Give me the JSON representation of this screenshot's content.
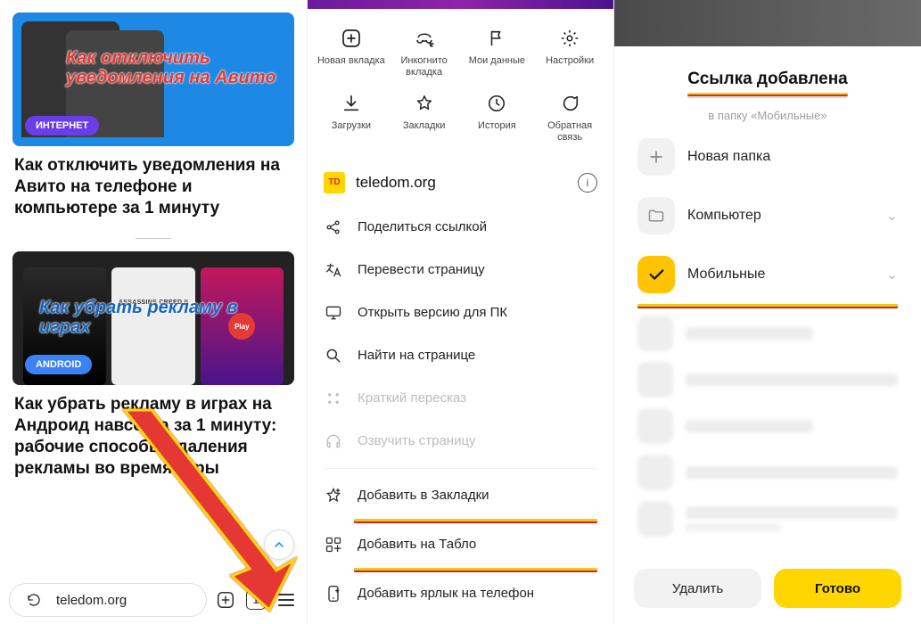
{
  "panel1": {
    "article1": {
      "overlay": "Как отключить уведомления на Авито",
      "badge": "ИНТЕРНЕТ",
      "headline": "Как отключить уведомления на Авито на телефоне и компьютере за 1 минуту"
    },
    "article2": {
      "overlay": "Как убрать рекламу в играх",
      "badge": "ANDROID",
      "headline": "Как убрать рекламу в играх на Андроид навсегда за 1 минуту: рабочие способы удаления рекламы во время игры"
    },
    "addressbar": {
      "url": "teledom.org",
      "tab_count": "1"
    }
  },
  "panel2": {
    "quick": [
      {
        "label": "Новая вкладка"
      },
      {
        "label": "Инкогнито вкладка"
      },
      {
        "label": "Мои данные"
      },
      {
        "label": "Настройки"
      },
      {
        "label": "Загрузки"
      },
      {
        "label": "Закладки"
      },
      {
        "label": "История"
      },
      {
        "label": "Обратная связь"
      }
    ],
    "site": {
      "favicon": "TD",
      "url": "teledom.org"
    },
    "menu": {
      "share": "Поделиться ссылкой",
      "translate": "Перевести страницу",
      "desktop": "Открыть версию для ПК",
      "find": "Найти на странице",
      "summary": "Краткий пересказ",
      "tts": "Озвучить страницу",
      "bookmark": "Добавить в Закладки",
      "tablo": "Добавить на Табло",
      "shortcut": "Добавить ярлык на телефон"
    }
  },
  "panel3": {
    "title": "Ссылка добавлена",
    "subtitle": "в папку «Мобильные»",
    "new_folder": "Новая папка",
    "folders": [
      {
        "label": "Компьютер"
      },
      {
        "label": "Мобильные"
      }
    ],
    "delete": "Удалить",
    "done": "Готово"
  }
}
